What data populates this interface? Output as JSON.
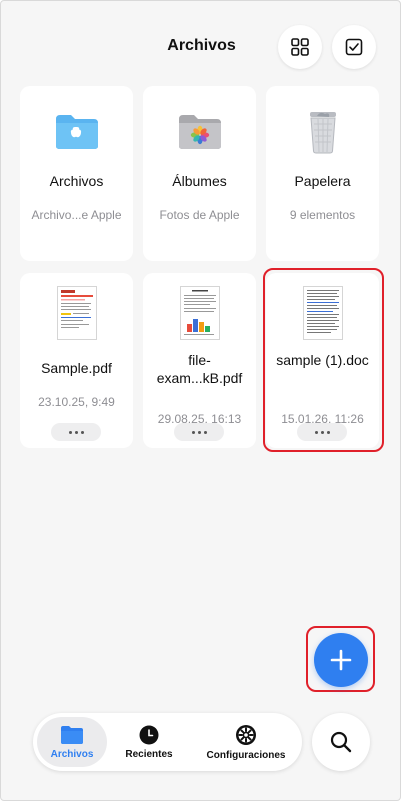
{
  "header": {
    "title": "Archivos"
  },
  "items": [
    {
      "name": "Archivos",
      "sub": "Archivo...e Apple",
      "icon": "folder-cloud-icon"
    },
    {
      "name": "Álbumes",
      "sub": "Fotos de Apple",
      "icon": "photos-folder-icon"
    },
    {
      "name": "Papelera",
      "sub": "9 elementos",
      "icon": "trash-icon"
    },
    {
      "name": "Sample.pdf",
      "sub": "23.10.25, 9:49",
      "icon": "pdf-thumbnail"
    },
    {
      "name": "file-exam...kB.pdf",
      "sub": "29.08.25, 16:13",
      "icon": "pdf-thumbnail"
    },
    {
      "name": "sample (1).doc",
      "sub": "15.01.26, 11:26",
      "icon": "doc-thumbnail"
    }
  ],
  "tabbar": {
    "files": "Archivos",
    "recent": "Recientes",
    "settings": "Configuraciones"
  },
  "colors": {
    "accent": "#2f7ff0",
    "highlight": "#e0202a",
    "background": "#f6f6f6"
  }
}
